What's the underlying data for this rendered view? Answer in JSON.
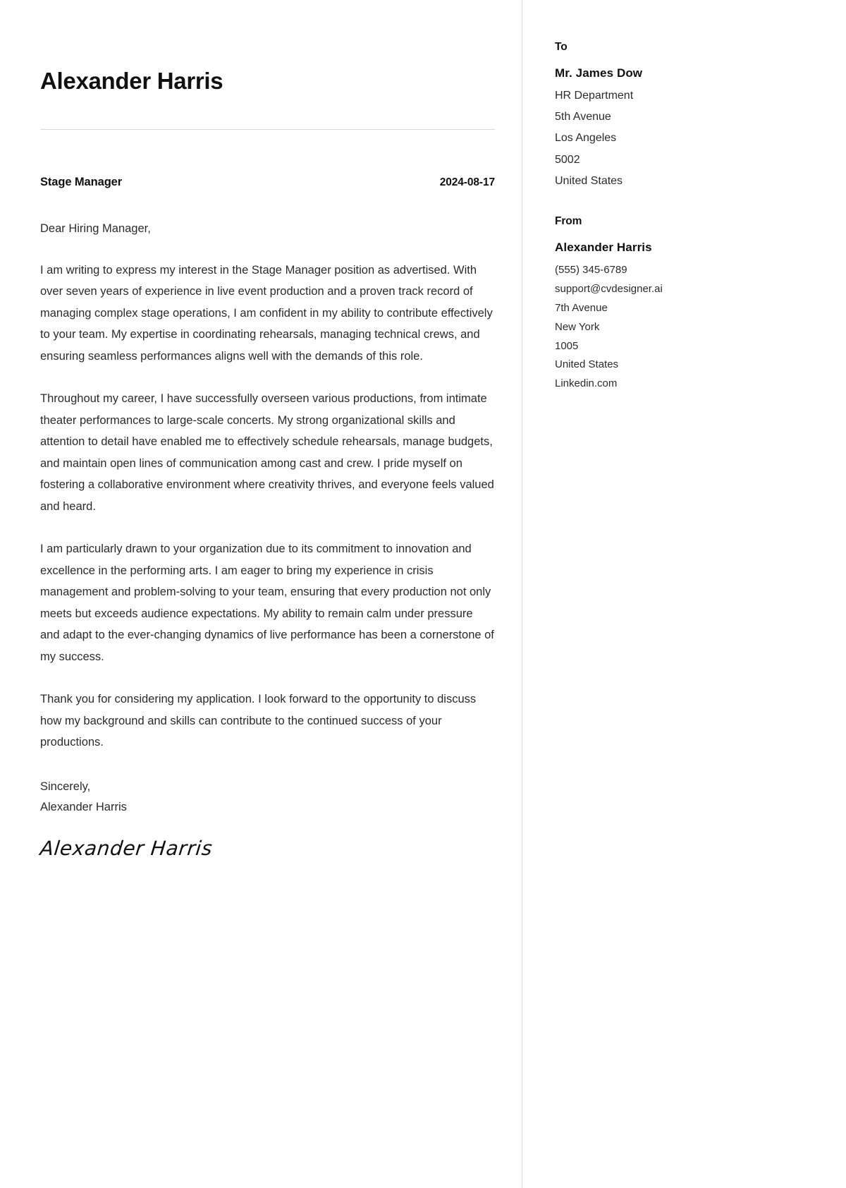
{
  "document": {
    "type": "cover-letter",
    "applicant_name": "Alexander Harris",
    "job_title": "Stage Manager",
    "date": "2024-08-17",
    "signature_name": "Alexander Harris"
  },
  "letter": {
    "salutation": "Dear Hiring Manager,",
    "paragraphs": [
      "I am writing to express my interest in the Stage Manager position as advertised. With over seven years of experience in live event production and a proven track record of managing complex stage operations, I am confident in my ability to contribute effectively to your team. My expertise in coordinating rehearsals, managing technical crews, and ensuring seamless performances aligns well with the demands of this role.",
      "Throughout my career, I have successfully overseen various productions, from intimate theater performances to large-scale concerts. My strong organizational skills and attention to detail have enabled me to effectively schedule rehearsals, manage budgets, and maintain open lines of communication among cast and crew. I pride myself on fostering a collaborative environment where creativity thrives, and everyone feels valued and heard.",
      "I am particularly drawn to your organization due to its commitment to innovation and excellence in the performing arts. I am eager to bring my experience in crisis management and problem-solving to your team, ensuring that every production not only meets but exceeds audience expectations. My ability to remain calm under pressure and adapt to the ever-changing dynamics of live performance has been a cornerstone of my success.",
      "Thank you for considering my application. I look forward to the opportunity to discuss how my background and skills can contribute to the continued success of your productions."
    ],
    "closing": "Sincerely,",
    "closing_name": "Alexander Harris"
  },
  "recipient": {
    "heading": "To",
    "name": "Mr. James Dow",
    "lines": [
      "HR Department",
      "5th Avenue",
      "Los Angeles",
      "5002",
      "United States"
    ]
  },
  "sender": {
    "heading": "From",
    "name": "Alexander Harris",
    "lines": [
      "(555) 345-6789",
      "support@cvdesigner.ai",
      "7th Avenue",
      "New York",
      "1005",
      "United States",
      "Linkedin.com"
    ]
  },
  "colors": {
    "text": "#1a1a1a",
    "body_text": "#2b2b2b",
    "rule": "#d8d8d8",
    "divider": "#dcdcdc",
    "background": "#ffffff"
  }
}
